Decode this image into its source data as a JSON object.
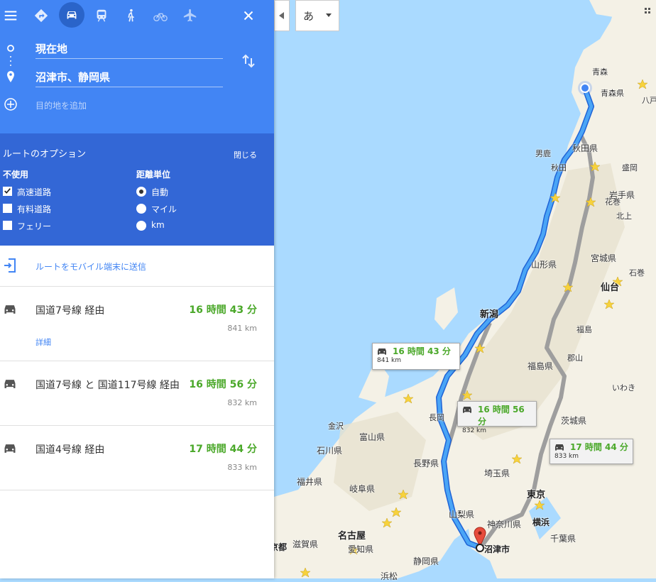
{
  "modes": [
    {
      "name": "menu-icon"
    },
    {
      "name": "best-route-icon"
    },
    {
      "name": "car-icon"
    },
    {
      "name": "transit-icon"
    },
    {
      "name": "walk-icon"
    },
    {
      "name": "bicycle-icon"
    },
    {
      "name": "flight-icon"
    },
    {
      "name": "close-icon"
    }
  ],
  "waypoints": {
    "origin": "現在地",
    "destination": "沼津市、静岡県",
    "add_placeholder": "目的地を追加"
  },
  "options": {
    "title": "ルートのオプション",
    "close": "閉じる",
    "avoid_header": "不使用",
    "avoid": [
      {
        "label": "高速道路",
        "checked": true
      },
      {
        "label": "有料道路",
        "checked": false
      },
      {
        "label": "フェリー",
        "checked": false
      }
    ],
    "units_header": "距離単位",
    "units": [
      {
        "label": "自動",
        "selected": true
      },
      {
        "label": "マイル",
        "selected": false
      },
      {
        "label": "km",
        "selected": false
      }
    ]
  },
  "send_to_mobile": "ルートをモバイル端末に送信",
  "routes": [
    {
      "name": "国道7号線 経由",
      "time": "16 時間 43 分",
      "distance": "841 km",
      "details": "詳細"
    },
    {
      "name": "国道7号線 と 国道117号線 経由",
      "time": "16 時間 56 分",
      "distance": "832 km"
    },
    {
      "name": "国道4号線 経由",
      "time": "17 時間 44 分",
      "distance": "833 km"
    }
  ],
  "map": {
    "ime_label": "あ",
    "labels": {
      "aomori": "青森",
      "aomori_pref": "青森県",
      "hachinohe": "八戸",
      "akita_pref": "秋田県",
      "oga": "男鹿",
      "akita": "秋田",
      "morioka": "盛岡",
      "iwate_pref": "岩手県",
      "hanamaki": "花巻",
      "kitakami": "北上",
      "miyagi_pref": "宮城県",
      "yamagata_pref": "山形県",
      "sendai": "仙台",
      "ishinomaki": "石巻",
      "niigata": "新潟",
      "fukushima": "福島",
      "fukushima_pref": "福島県",
      "koriyama": "郡山",
      "iwaki": "いわき",
      "nagaoka": "長岡",
      "ibaraki_pref": "茨城県",
      "kanazawa": "金沢",
      "toyama_pref": "富山県",
      "ishikawa_pref": "石川県",
      "nagano_pref": "長野県",
      "saitama_pref": "埼玉県",
      "fukui_pref": "福井県",
      "gifu_pref": "岐阜県",
      "tokyo": "東京",
      "yamanashi_pref": "山梨県",
      "kanagawa_pref": "神奈川県",
      "yokohama": "横浜",
      "chiba_pref": "千葉県",
      "nagoya": "名古屋",
      "kyoto": "京都",
      "shiga_pref": "滋賀県",
      "aichi_pref": "愛知県",
      "shizuoka_pref": "静岡県",
      "numazu": "沼津市",
      "hamamatsu": "浜松"
    },
    "bubbles": [
      {
        "time": "16 時間 43 分",
        "distance": "841 km"
      },
      {
        "time": "16 時間 56 分",
        "distance": "832 km"
      },
      {
        "time": "17 時間 44 分",
        "distance": "833 km"
      }
    ]
  },
  "colors": {
    "panel_blue": "#4285f4",
    "options_blue": "#3367d6",
    "route_primary": "#4a90f0",
    "route_alt": "#9e9e9e",
    "time_green": "#4aa829"
  }
}
